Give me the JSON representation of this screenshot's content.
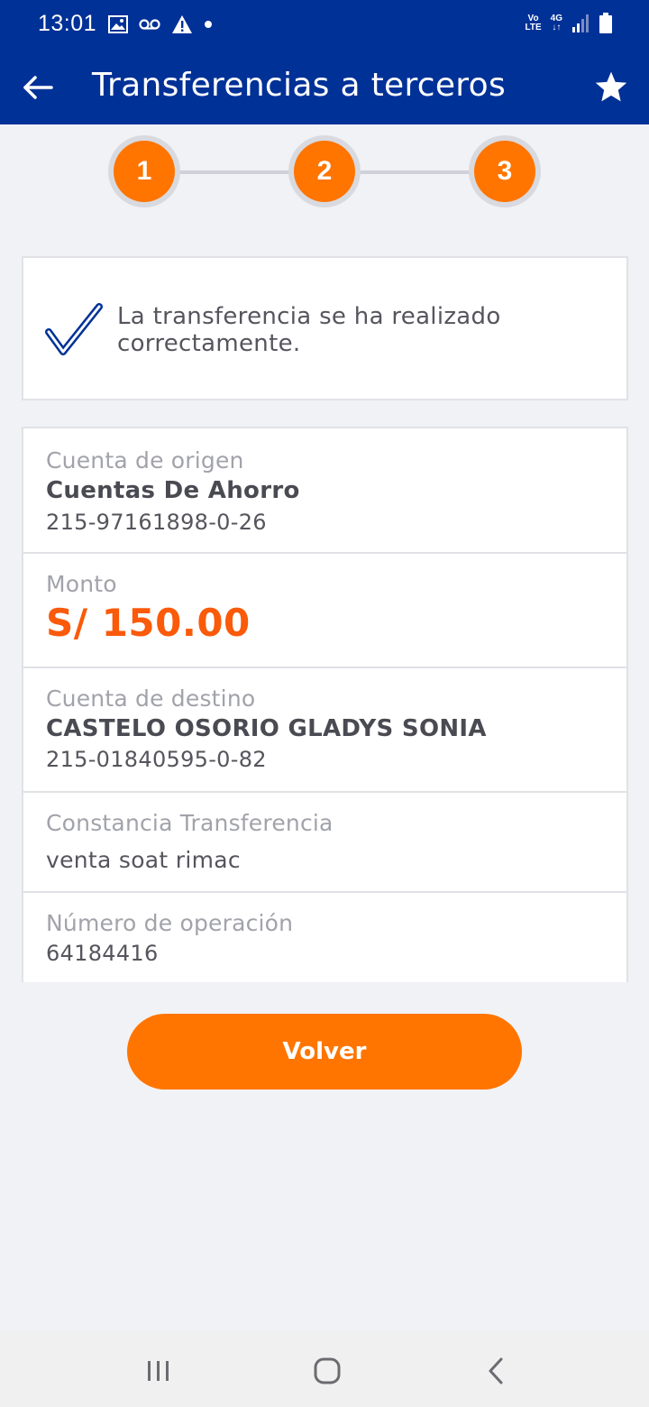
{
  "status_bar": {
    "time": "13:01",
    "left_icons": [
      "image-icon",
      "voicemail-icon",
      "warning-icon",
      "dot-icon"
    ],
    "volte_label_top": "Vo",
    "volte_label_bottom": "LTE",
    "network_label": "4G",
    "right_icons": [
      "volte-icon",
      "network-4g-icon",
      "signal-icon",
      "battery-icon"
    ]
  },
  "app_bar": {
    "title": "Transferencias a terceros",
    "back_icon": "arrow-left-icon",
    "favorite_icon": "star-icon"
  },
  "stepper": {
    "steps": [
      "1",
      "2",
      "3"
    ]
  },
  "success": {
    "message": "La transferencia se ha realizado correctamente.",
    "icon": "check-icon"
  },
  "details": {
    "origin": {
      "label": "Cuenta de origen",
      "account_type": "Cuentas De Ahorro",
      "account_number": "215-97161898-0-26"
    },
    "amount": {
      "label": "Monto",
      "value": "S/ 150.00"
    },
    "destination": {
      "label": "Cuenta de destino",
      "name": "CASTELO OSORIO GLADYS SONIA",
      "account_number": "215-01840595-0-82"
    },
    "receipt": {
      "label": "Constancia Transferencia",
      "value": "venta soat rimac"
    },
    "operation": {
      "label": "Número de operación",
      "value": "64184416"
    }
  },
  "actions": {
    "back_label": "Volver"
  },
  "nav_bar": {
    "icons": [
      "recent-apps-icon",
      "home-icon",
      "back-icon"
    ]
  },
  "colors": {
    "primary": "#003197",
    "accent": "#ff7500",
    "amount": "#fa5a0a",
    "background": "#f1f2f6"
  }
}
